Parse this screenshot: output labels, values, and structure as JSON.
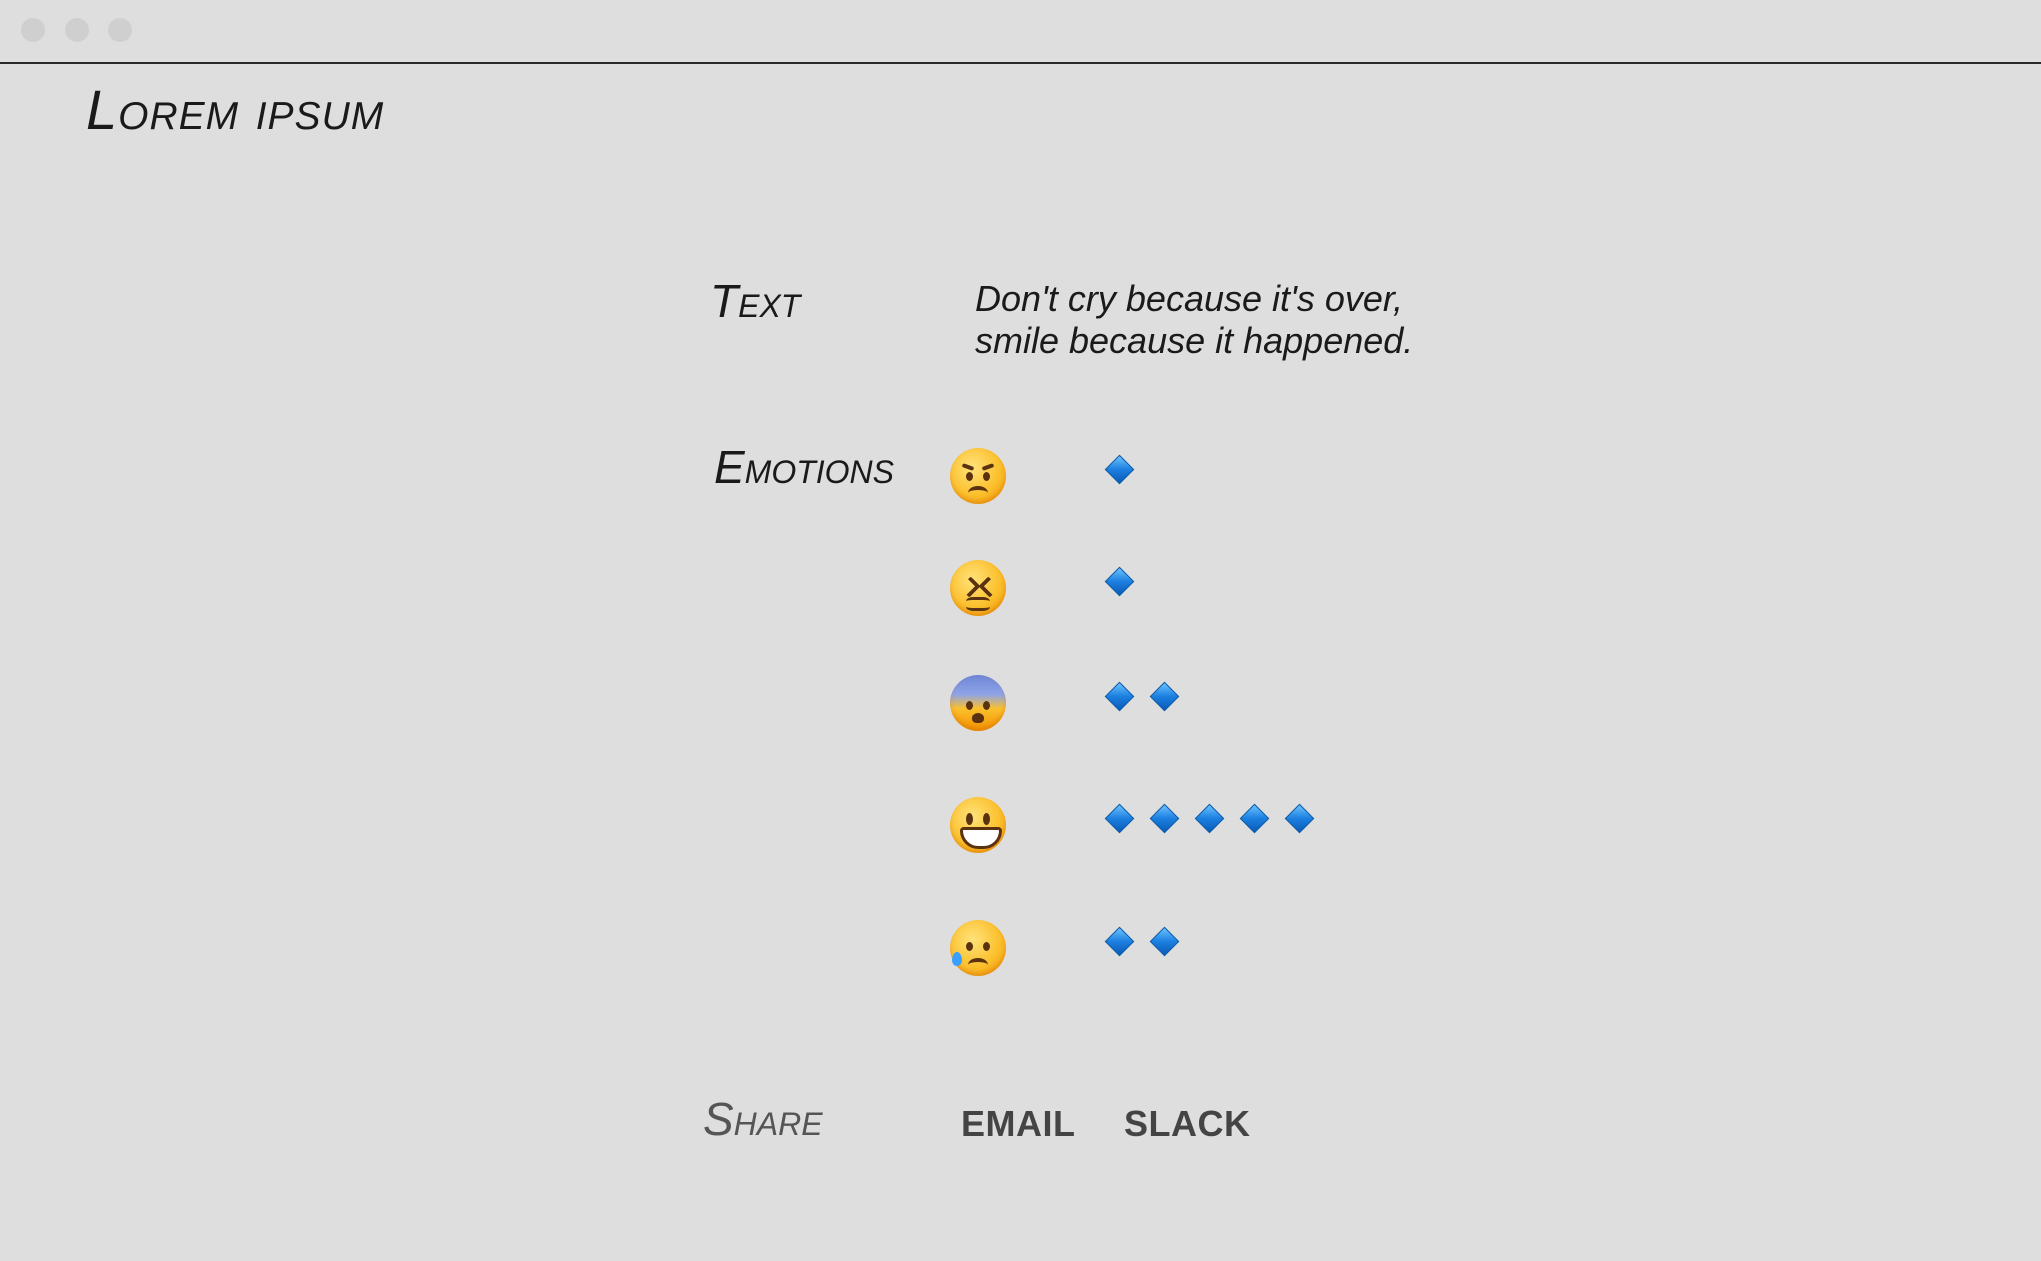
{
  "window": {
    "title": "Lorem ipsum"
  },
  "sections": {
    "text_label": "Text",
    "emotions_label": "Emotions",
    "share_label": "Share"
  },
  "quote": {
    "line1": "Don't cry because it's over,",
    "line2": "smile because it happened."
  },
  "emotions": [
    {
      "icon": "angry-face-icon",
      "level": 1
    },
    {
      "icon": "confounded-face-icon",
      "level": 1
    },
    {
      "icon": "fearful-face-icon",
      "level": 2
    },
    {
      "icon": "grinning-face-icon",
      "level": 5
    },
    {
      "icon": "sad-sweat-face-icon",
      "level": 2
    }
  ],
  "rating_icon": "blue-diamond-icon",
  "share": {
    "email_label": "EMAIL",
    "slack_label": "SLACK"
  },
  "colors": {
    "background": "#dedede",
    "diamond": "#1b7fe0",
    "share_link": "#444444"
  }
}
